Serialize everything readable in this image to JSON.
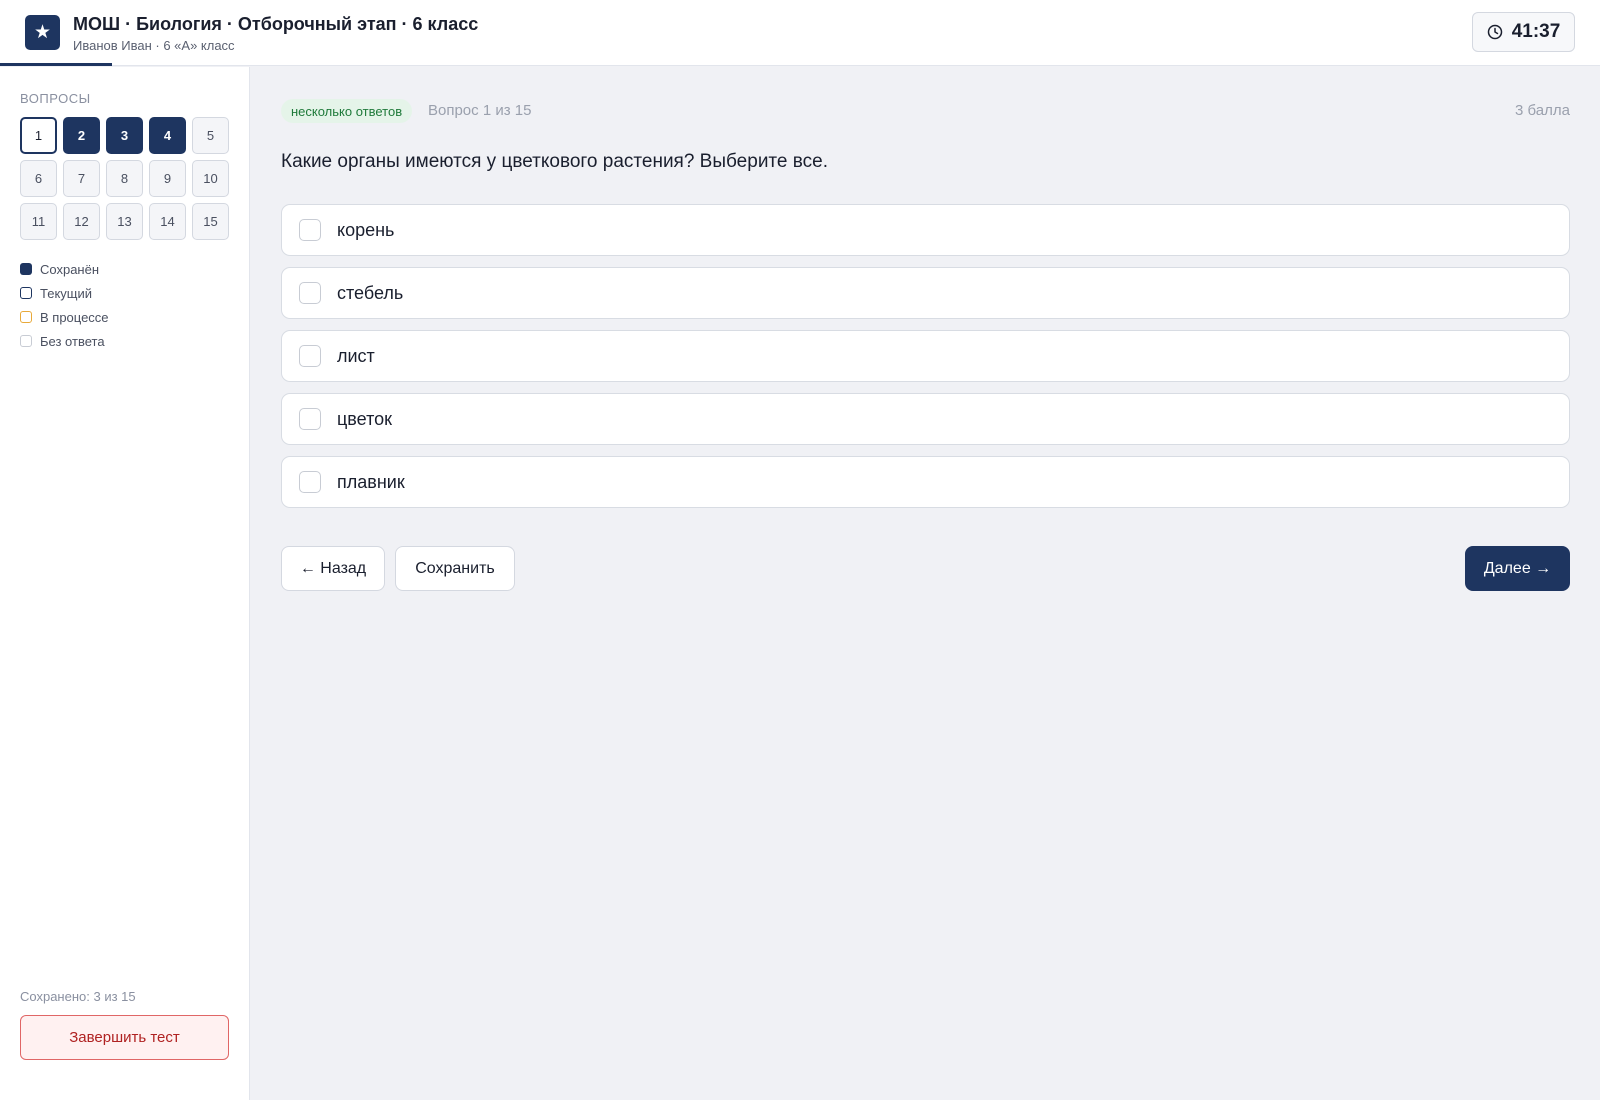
{
  "header": {
    "title": "МОШ · Биология · Отборочный этап · 6 класс",
    "subtitle": "Иванов Иван · 6 «А» класс",
    "timer": "41:37",
    "progress": 0.07
  },
  "sidebar": {
    "heading": "ВОПРОСЫ",
    "questions": [
      {
        "label": "1",
        "state": "current"
      },
      {
        "label": "2",
        "state": "saved"
      },
      {
        "label": "3",
        "state": "saved"
      },
      {
        "label": "4",
        "state": "saved"
      },
      {
        "label": "5",
        "state": "none"
      },
      {
        "label": "6",
        "state": "none"
      },
      {
        "label": "7",
        "state": "none"
      },
      {
        "label": "8",
        "state": "none"
      },
      {
        "label": "9",
        "state": "none"
      },
      {
        "label": "10",
        "state": "none"
      },
      {
        "label": "11",
        "state": "none"
      },
      {
        "label": "12",
        "state": "none"
      },
      {
        "label": "13",
        "state": "none"
      },
      {
        "label": "14",
        "state": "none"
      },
      {
        "label": "15",
        "state": "none"
      }
    ],
    "legend": [
      {
        "label": "Сохранён",
        "state": "saved"
      },
      {
        "label": "Текущий",
        "state": "current"
      },
      {
        "label": "В процессе",
        "state": "progress"
      },
      {
        "label": "Без ответа",
        "state": "none"
      }
    ],
    "saved_count": "Сохранено: 3 из 15",
    "finish_label": "Завершить тест"
  },
  "main": {
    "tag": "несколько ответов",
    "question_number": "Вопрос 1 из 15",
    "points": "3 балла",
    "question_text": "Какие органы имеются у цветкового растения? Выберите все.",
    "options": [
      {
        "label": "корень",
        "checked": false
      },
      {
        "label": "стебель",
        "checked": false
      },
      {
        "label": "лист",
        "checked": false
      },
      {
        "label": "цветок",
        "checked": false
      },
      {
        "label": "плавник",
        "checked": false
      }
    ],
    "back_label": "← Назад",
    "save_label": "Сохранить",
    "next_label": "Далее →"
  },
  "colors": {
    "accent": "#1e3560",
    "tag_bg": "#e5f4e9",
    "tag_text": "#1f7a3a",
    "danger": "#b02222",
    "in_progress": "#e8a93a"
  },
  "icons": {
    "logo": "star-icon",
    "timer": "clock-icon"
  }
}
